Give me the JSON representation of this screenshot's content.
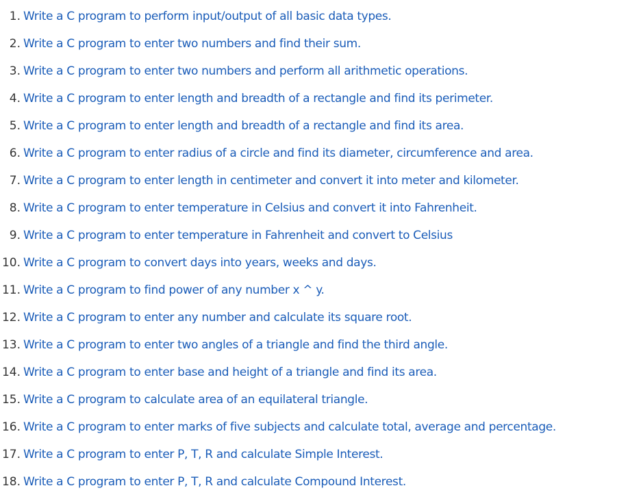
{
  "exercises": [
    {
      "num": "1.",
      "text": "Write a C program to perform input/output of all basic data types."
    },
    {
      "num": "2.",
      "text": "Write a C program to enter two numbers and find their sum."
    },
    {
      "num": "3.",
      "text": "Write a C program to enter two numbers and perform all arithmetic operations."
    },
    {
      "num": "4.",
      "text": "Write a C program to enter length and breadth of a rectangle and find its perimeter."
    },
    {
      "num": "5.",
      "text": "Write a C program to enter length and breadth of a rectangle and find its area."
    },
    {
      "num": "6.",
      "text": "Write a C program to enter radius of a circle and find its diameter, circumference and area."
    },
    {
      "num": "7.",
      "text": "Write a C program to enter length in centimeter and convert it into meter and kilometer."
    },
    {
      "num": "8.",
      "text": "Write a C program to enter temperature in Celsius and convert it into Fahrenheit."
    },
    {
      "num": "9.",
      "text": "Write a C program to enter temperature in Fahrenheit and convert to Celsius"
    },
    {
      "num": "10.",
      "text": "Write a C program to convert days into years, weeks and days."
    },
    {
      "num": "11.",
      "text": "Write a C program to find power of any number x ^ y."
    },
    {
      "num": "12.",
      "text": "Write a C program to enter any number and calculate its square root."
    },
    {
      "num": "13.",
      "text": "Write a C program to enter two angles of a triangle and find the third angle."
    },
    {
      "num": "14.",
      "text": "Write a C program to enter base and height of a triangle and find its area."
    },
    {
      "num": "15.",
      "text": "Write a C program to calculate area of an equilateral triangle."
    },
    {
      "num": "16.",
      "text": "Write a C program to enter marks of five subjects and calculate total, average and percentage."
    },
    {
      "num": "17.",
      "text": "Write a C program to enter P, T, R and calculate Simple Interest."
    },
    {
      "num": "18.",
      "text": "Write a C program to enter P, T, R and calculate Compound Interest."
    }
  ],
  "colors": {
    "link": "#1a5cb8",
    "number": "#333333",
    "background": "#ffffff"
  }
}
